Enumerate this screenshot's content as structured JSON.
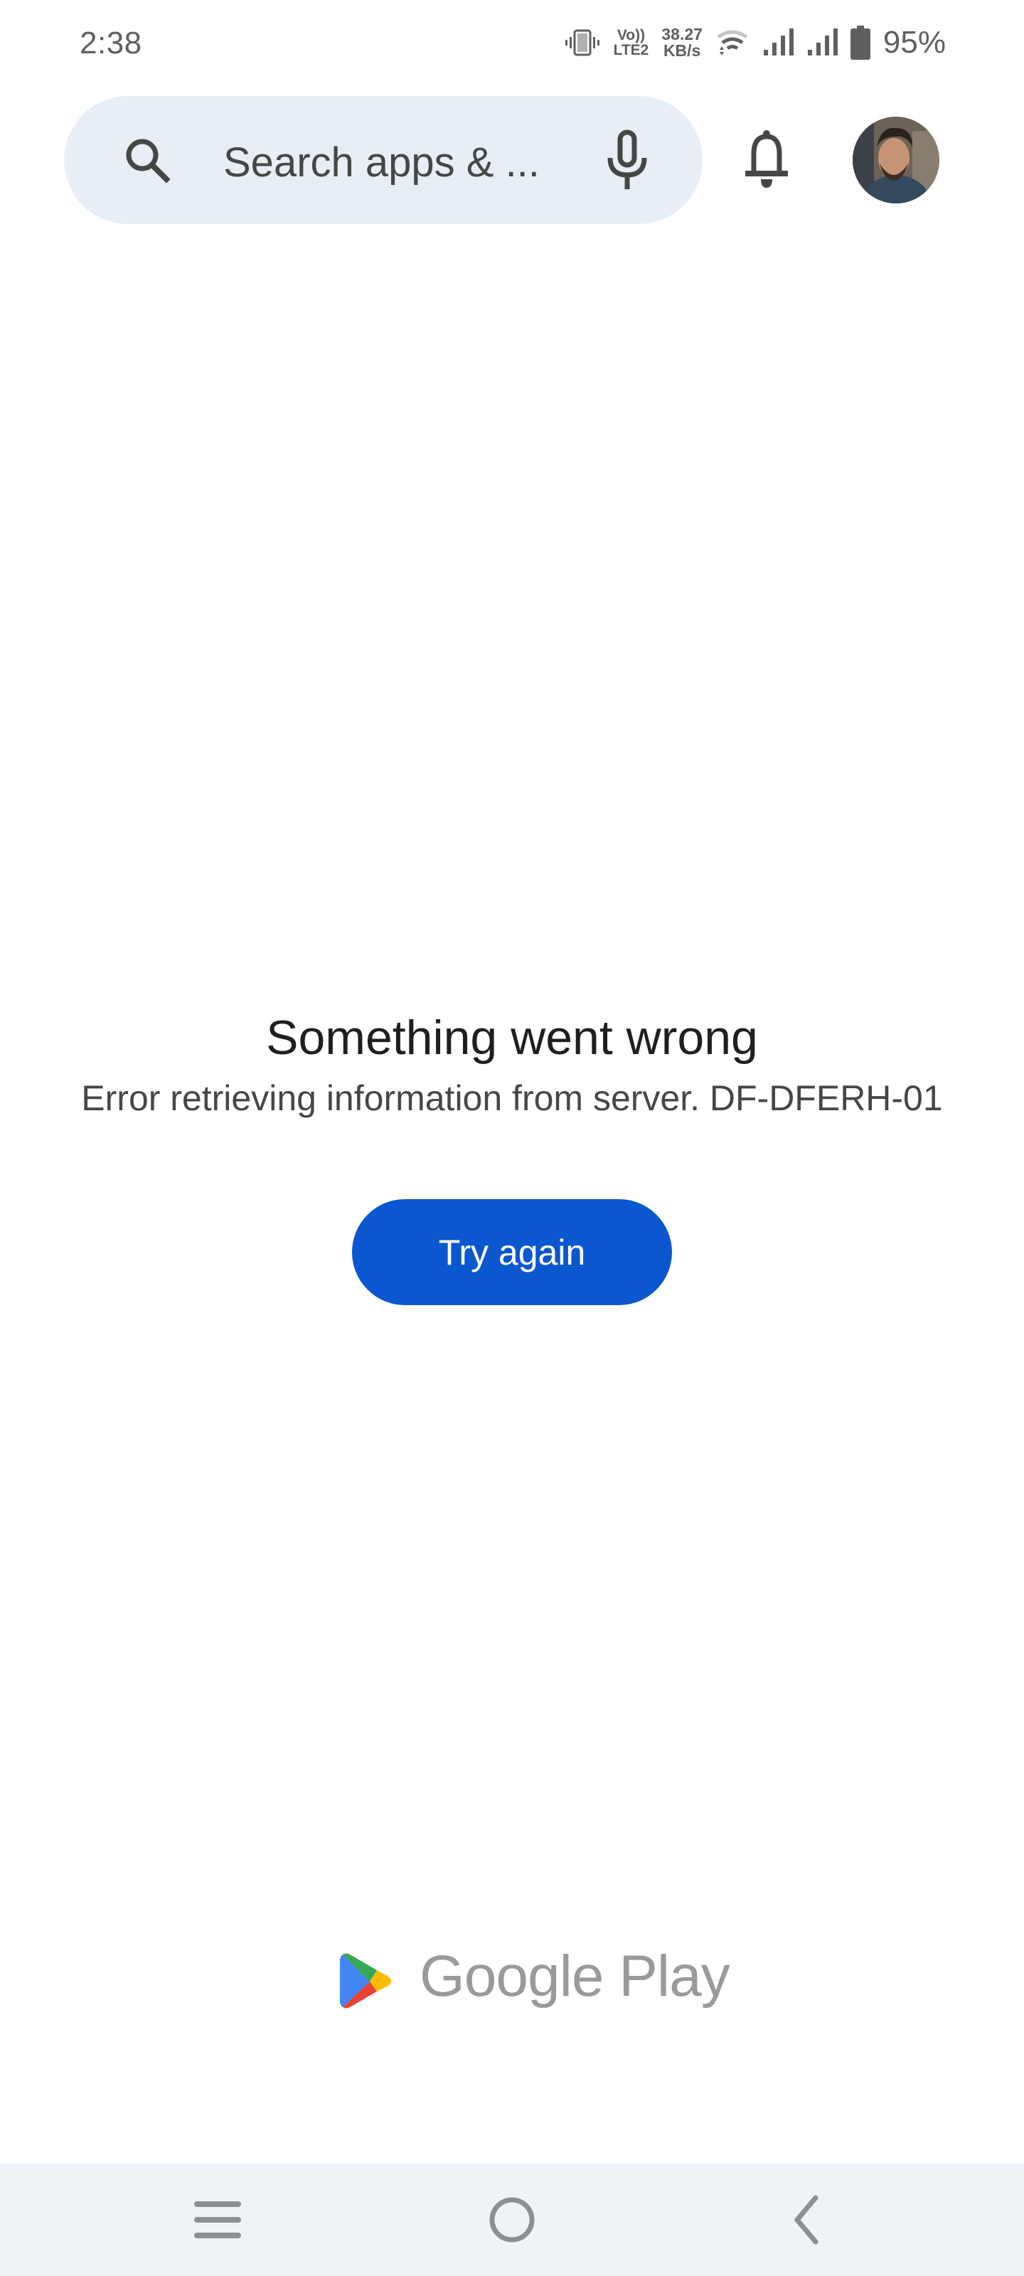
{
  "status_bar": {
    "time": "2:38",
    "volte_top": "Vo))",
    "volte_bottom": "LTE2",
    "speed_value": "38.27",
    "speed_unit": "KB/s",
    "battery_percent": "95%",
    "icons": [
      "vibrate-icon",
      "volte-icon",
      "wifi-icon",
      "signal-icon",
      "signal-icon",
      "battery-icon"
    ]
  },
  "header": {
    "search_placeholder": "Search apps & ...",
    "search_value": "",
    "icons": [
      "search-icon",
      "mic-icon",
      "bell-icon"
    ],
    "avatar_label": "Account"
  },
  "error": {
    "title": "Something went wrong",
    "message": "Error retrieving information from server. DF-DFERH-01",
    "button_label": "Try again",
    "button_color": "#0b57d0"
  },
  "footer": {
    "brand": "Google Play",
    "logo_colors": {
      "green": "#34a853",
      "blue": "#4285f4",
      "yellow": "#fbbc04",
      "red": "#ea4335"
    }
  },
  "nav_bar": {
    "buttons": [
      "recents",
      "home",
      "back"
    ]
  }
}
